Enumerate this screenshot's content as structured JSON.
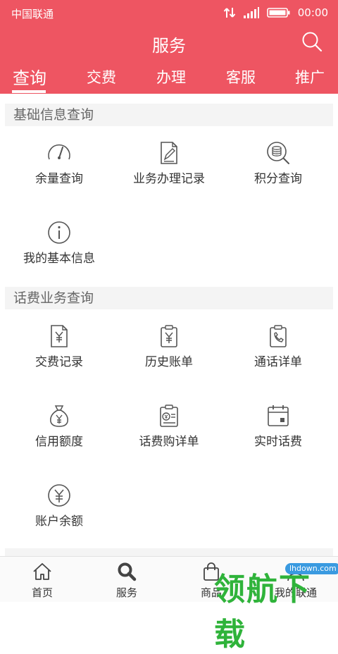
{
  "status_bar": {
    "carrier": "中国联通",
    "time": "00:00"
  },
  "header": {
    "title": "服务"
  },
  "tabs": [
    {
      "label": "查询",
      "active": true
    },
    {
      "label": "交费",
      "active": false
    },
    {
      "label": "办理",
      "active": false
    },
    {
      "label": "客服",
      "active": false
    },
    {
      "label": "推广",
      "active": false
    }
  ],
  "sections": [
    {
      "title": "基础信息查询",
      "items": [
        {
          "label": "余量查询",
          "icon": "gauge-icon"
        },
        {
          "label": "业务办理记录",
          "icon": "document-edit-icon"
        },
        {
          "label": "积分查询",
          "icon": "coins-search-icon"
        },
        {
          "label": "我的基本信息",
          "icon": "info-icon"
        }
      ]
    },
    {
      "title": "话费业务查询",
      "items": [
        {
          "label": "交费记录",
          "icon": "yen-document-icon"
        },
        {
          "label": "历史账单",
          "icon": "yen-clipboard-icon"
        },
        {
          "label": "通话详单",
          "icon": "phone-clipboard-icon"
        },
        {
          "label": "信用额度",
          "icon": "money-bag-icon"
        },
        {
          "label": "话费购详单",
          "icon": "bill-clipboard-icon"
        },
        {
          "label": "实时话费",
          "icon": "calendar-icon"
        },
        {
          "label": "账户余额",
          "icon": "yen-circle-icon"
        }
      ]
    }
  ],
  "bottom_nav": [
    {
      "label": "首页",
      "icon": "home-icon"
    },
    {
      "label": "服务",
      "icon": "search-icon"
    },
    {
      "label": "商品",
      "icon": "bag-icon"
    },
    {
      "label": "我的联通",
      "icon": "user-icon"
    }
  ],
  "watermark": {
    "text": "领航下载",
    "site": "lhdown.com"
  },
  "colors": {
    "brand": "#ee5562",
    "icon": "#555555"
  }
}
